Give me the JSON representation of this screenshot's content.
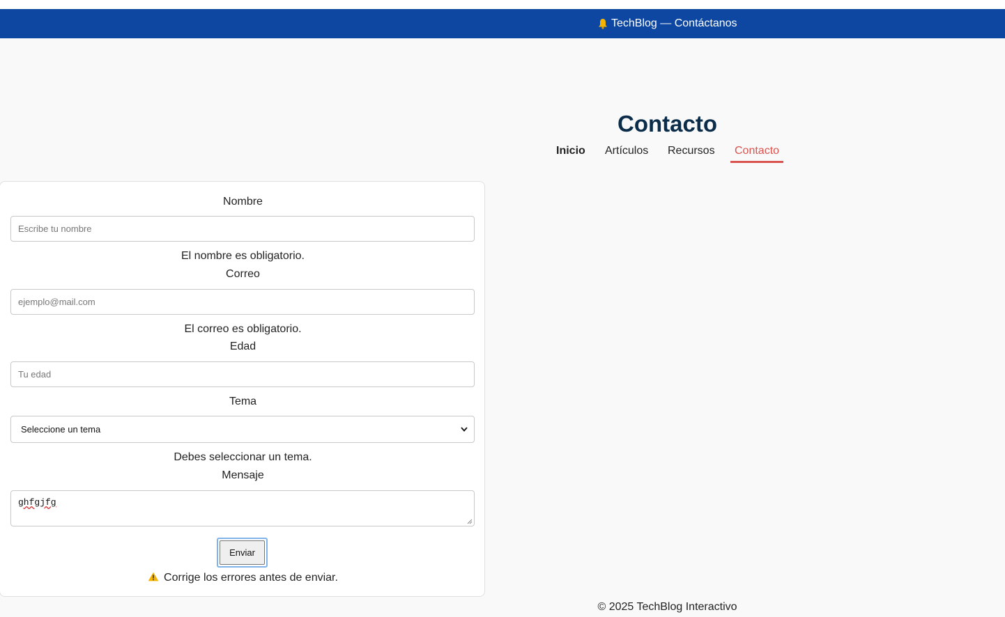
{
  "header": {
    "banner_text": "TechBlog — Contáctanos",
    "bell_icon": "bell-icon",
    "bell_color": "#f5b400",
    "banner_color": "#0d47a1"
  },
  "page_title": "Contacto",
  "nav": {
    "items": [
      {
        "label": "Inicio"
      },
      {
        "label": "Artículos"
      },
      {
        "label": "Recursos"
      },
      {
        "label": "Contacto"
      }
    ],
    "active_color": "#d9534f"
  },
  "form": {
    "name_label": "Nombre",
    "name_placeholder": "Escribe tu nombre",
    "name_error": "El nombre es obligatorio.",
    "email_label": "Correo",
    "email_placeholder": "ejemplo@mail.com",
    "email_error": "El correo es obligatorio.",
    "age_label": "Edad",
    "age_placeholder": "Tu edad",
    "topic_label": "Tema",
    "topic_selected": "Seleccione un tema",
    "topic_error": "Debes seleccionar un tema.",
    "message_label": "Mensaje",
    "message_value": "ghfgjfg",
    "submit_label": "Enviar",
    "form_error": "Corrige los errores antes de enviar.",
    "warning_icon": "warning-icon"
  },
  "footer": {
    "text": "© 2025 TechBlog Interactivo"
  }
}
